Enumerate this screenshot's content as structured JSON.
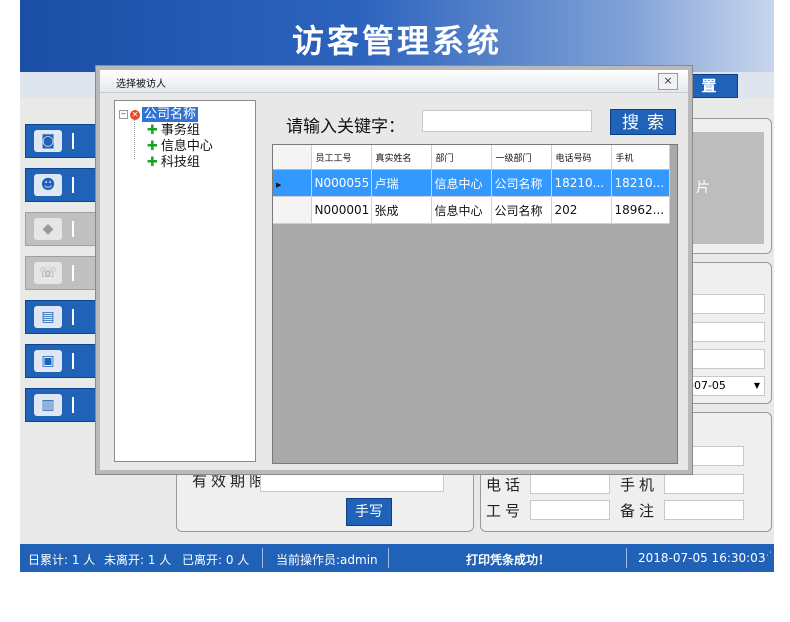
{
  "app": {
    "title": "访客管理系统",
    "settings_label": "置",
    "photo_label": "片",
    "date_value": "-07-05",
    "labels": {
      "valid_period": "有效期限",
      "phone": "电话",
      "mobile": "手机",
      "work_no": "工号",
      "remark": "备注"
    },
    "handwrite_label": "手写"
  },
  "sidebar": [
    {
      "icon": "camera-icon",
      "glyph": "◙"
    },
    {
      "icon": "person-icon",
      "glyph": "☻"
    },
    {
      "icon": "tag-icon",
      "glyph": "◆"
    },
    {
      "icon": "phone-icon",
      "glyph": "☏"
    },
    {
      "icon": "card-icon",
      "glyph": "▤"
    },
    {
      "icon": "folder-icon",
      "glyph": "▣"
    },
    {
      "icon": "trash-icon",
      "glyph": "▥"
    }
  ],
  "status": {
    "today_total": "日累计: 1 人",
    "not_left": "未离开: 1 人",
    "left": "已离开: 0 人",
    "operator": "当前操作员:admin",
    "message": "打印凭条成功！",
    "datetime": "2018-07-05 16:30:03"
  },
  "dialog": {
    "title": "选择被访人",
    "close_label": "×",
    "tree": {
      "root": "公司名称",
      "children": [
        "事务组",
        "信息中心",
        "科技组"
      ]
    },
    "keyword_label": "请输入关键字：",
    "keyword_value": "",
    "search_label": "搜索",
    "table": {
      "columns": [
        "员工工号",
        "真实姓名",
        "部门",
        "一级部门",
        "电话号码",
        "手机"
      ],
      "rows": [
        [
          "N000055",
          "卢瑞",
          "信息中心",
          "公司名称",
          "18210...",
          "18210..."
        ],
        [
          "N000001",
          "张成",
          "信息中心",
          "公司名称",
          "202",
          "18962..."
        ]
      ]
    }
  },
  "colors": {
    "accent": "#1f62b7",
    "selection": "#3399ff"
  }
}
